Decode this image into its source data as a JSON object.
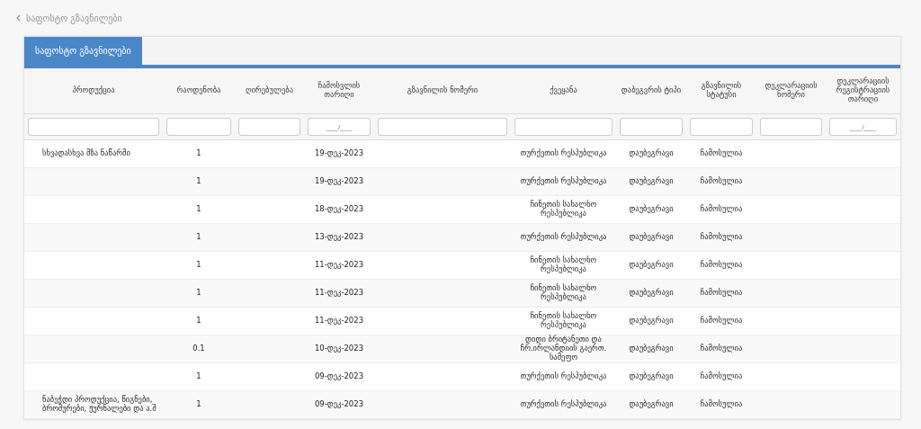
{
  "breadcrumb": {
    "label": "საფოსტო გზავნილები"
  },
  "tabs": [
    {
      "label": "საფოსტო გზავნილები",
      "selected": true
    }
  ],
  "table": {
    "columns": [
      {
        "label": "პროდუქცია",
        "filter": {
          "kind": "text"
        }
      },
      {
        "label": "რაოდენობა",
        "filter": {
          "kind": "text"
        }
      },
      {
        "label": "ღირებულება",
        "filter": {
          "kind": "text"
        }
      },
      {
        "label": "ჩამოსვლის თარიღი",
        "filter": {
          "kind": "date",
          "placeholder": "___/___"
        }
      },
      {
        "label": "გზავნილის ნომერი",
        "filter": {
          "kind": "text"
        }
      },
      {
        "label": "ქვეყანა",
        "filter": {
          "kind": "text"
        }
      },
      {
        "label": "დაბეგვრის ტიპი",
        "filter": {
          "kind": "text"
        }
      },
      {
        "label": "გზავნილის სტატუსი",
        "filter": {
          "kind": "text"
        }
      },
      {
        "label": "დეკლარაციის ნომერი",
        "filter": {
          "kind": "text"
        }
      },
      {
        "label": "დეკლარაციის რეგისტრაციის თარიღი",
        "filter": {
          "kind": "date",
          "placeholder": "___/___"
        }
      }
    ],
    "rows": [
      {
        "product": "სხვადასხვა მზა ნაწარმი",
        "quantity": "1",
        "date": "19-დეკ-2023",
        "country": "თურქეთის რესპუბლიკა",
        "tax_type": "დაუბეგრავი",
        "status": "ჩამოსულია"
      },
      {
        "quantity": "1",
        "date": "19-დეკ-2023",
        "country": "თურქეთის რესპუბლიკა",
        "tax_type": "დაუბეგრავი",
        "status": "ჩამოსულია"
      },
      {
        "quantity": "1",
        "date": "18-დეკ-2023",
        "country": "ჩინეთის სახალხო რესპუბლიკა",
        "tax_type": "დაუბეგრავი",
        "status": "ჩამოსულია"
      },
      {
        "quantity": "1",
        "date": "13-დეკ-2023",
        "country": "თურქეთის რესპუბლიკა",
        "tax_type": "დაუბეგრავი",
        "status": "ჩამოსულია"
      },
      {
        "quantity": "1",
        "date": "11-დეკ-2023",
        "country": "ჩინეთის სახალხო რესპუბლიკა",
        "tax_type": "დაუბეგრავი",
        "status": "ჩამოსულია"
      },
      {
        "quantity": "1",
        "date": "11-დეკ-2023",
        "country": "ჩინეთის სახალხო რესპუბლიკა",
        "tax_type": "დაუბეგრავი",
        "status": "ჩამოსულია"
      },
      {
        "quantity": "1",
        "date": "11-დეკ-2023",
        "country": "ჩინეთის სახალხო რესპუბლიკა",
        "tax_type": "დაუბეგრავი",
        "status": "ჩამოსულია"
      },
      {
        "quantity": "0.1",
        "date": "10-დეკ-2023",
        "country": "დიდი ბრიტანეთი და ჩრ.ირლანდიის გაერთ. სამეფო",
        "tax_type": "დაუბეგრავი",
        "status": "ჩამოსულია"
      },
      {
        "quantity": "1",
        "date": "09-დეკ-2023",
        "country": "თურქეთის რესპუბლიკა",
        "tax_type": "დაუბეგრავი",
        "status": "ჩამოსულია"
      },
      {
        "product": "ნაბეჭდი პროდუქცია, წიგნები, ბროშურები, ჟურნალები და ა.შ",
        "quantity": "1",
        "date": "09-დეკ-2023",
        "country": "თურქეთის რესპუბლიკა",
        "tax_type": "დაუბეგრავი",
        "status": "ჩამოსულია"
      }
    ]
  }
}
